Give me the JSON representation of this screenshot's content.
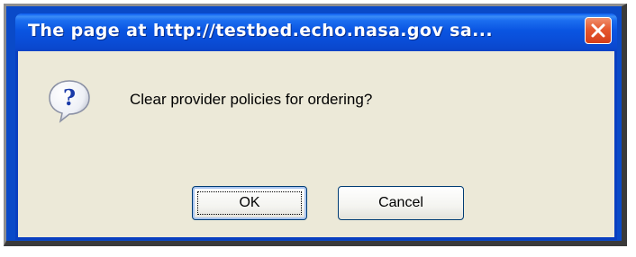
{
  "dialog": {
    "title": "The page at http://testbed.echo.nasa.gov sa...",
    "message": "Clear provider policies for ordering?",
    "icon": "question-icon",
    "close_icon": "close-icon",
    "buttons": {
      "ok_label": "OK",
      "cancel_label": "Cancel"
    }
  },
  "colors": {
    "titlebar": "#0a55e2",
    "window_bg": "#ece9d8",
    "close_button": "#e5582f",
    "focus_border": "#a9c4ef"
  }
}
